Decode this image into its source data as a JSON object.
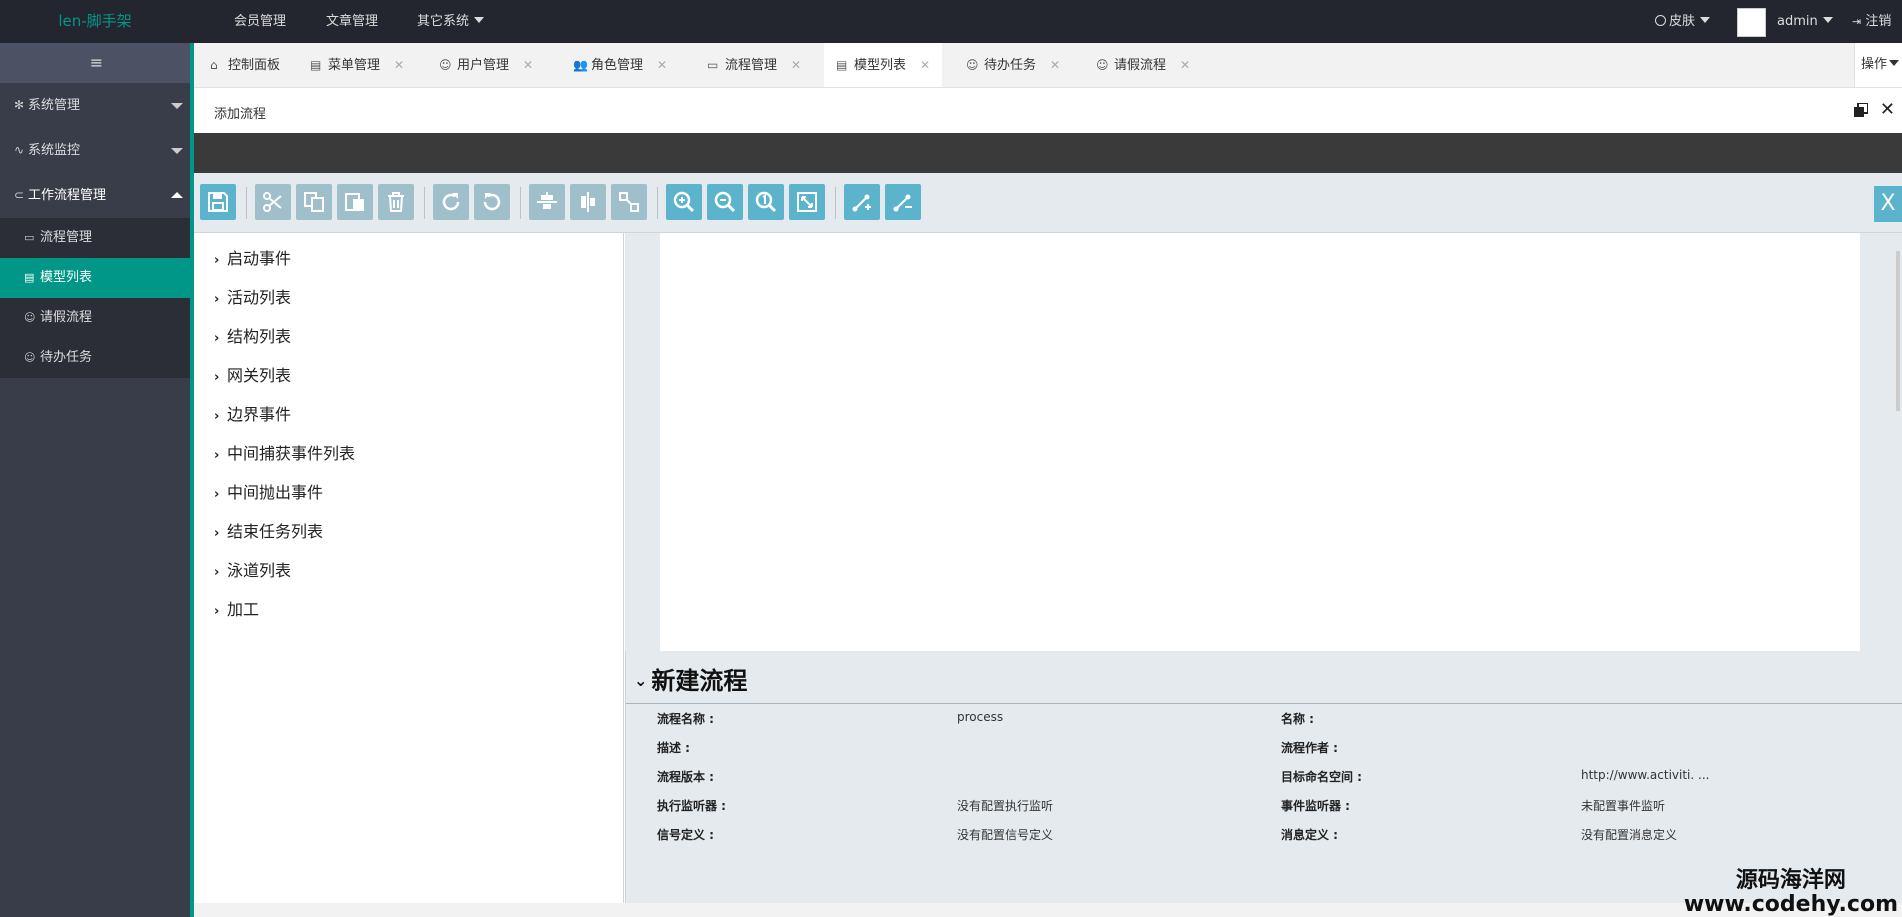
{
  "topbar": {
    "brand": "len-脚手架",
    "nav": [
      "会员管理",
      "文章管理",
      "其它系统"
    ],
    "skin": "皮肤",
    "user": "admin",
    "logout": "注销"
  },
  "sidebar": {
    "toggle": "≡",
    "menus": [
      {
        "label": "系统管理"
      },
      {
        "label": "系统监控"
      },
      {
        "label": "工作流程管理"
      }
    ],
    "submenu": [
      "流程管理",
      "模型列表",
      "请假流程",
      "待办任务"
    ]
  },
  "tabs": {
    "items": [
      "控制面板",
      "菜单管理",
      "用户管理",
      "角色管理",
      "流程管理",
      "模型列表",
      "待办任务",
      "请假流程"
    ],
    "ops": "操作"
  },
  "page": {
    "title": "添加流程"
  },
  "toolbar": {
    "close": "X"
  },
  "palette": {
    "items": [
      "启动事件",
      "活动列表",
      "结构列表",
      "网关列表",
      "边界事件",
      "中间捕获事件列表",
      "中间抛出事件",
      "结束任务列表",
      "泳道列表",
      "加工"
    ]
  },
  "properties": {
    "title": "新建流程",
    "rows": [
      {
        "l1": "流程名称 :",
        "v1": "process",
        "l2": "名称 :",
        "v2": ""
      },
      {
        "l1": "描述 :",
        "v1": "",
        "l2": "流程作者 :",
        "v2": ""
      },
      {
        "l1": "流程版本 :",
        "v1": "",
        "l2": "目标命名空间 :",
        "v2": "http://www.activiti. ..."
      },
      {
        "l1": "执行监听器 :",
        "v1": "没有配置执行监听",
        "l2": "事件监听器 :",
        "v2": "未配置事件监听"
      },
      {
        "l1": "信号定义 :",
        "v1": "没有配置信号定义",
        "l2": "消息定义 :",
        "v2": "没有配置消息定义"
      }
    ]
  },
  "watermark": {
    "line1": "源码海洋网",
    "line2": "www.codehy.com"
  }
}
